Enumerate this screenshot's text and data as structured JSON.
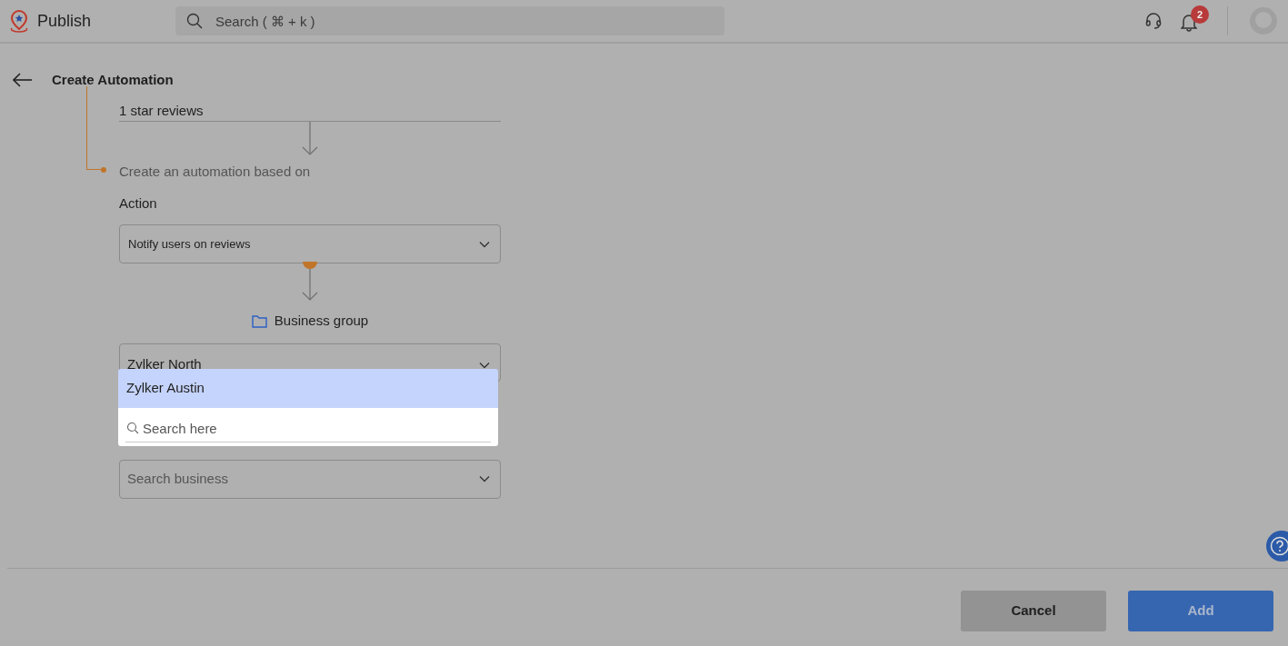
{
  "app": {
    "name": "Publish"
  },
  "search": {
    "placeholder": "Search ( ⌘ + k )"
  },
  "notifications": {
    "count": "2"
  },
  "page": {
    "title": "Create Automation"
  },
  "trigger": {
    "label": "1 star reviews"
  },
  "automation": {
    "caption": "Create an automation based on",
    "action_label": "Action",
    "action_value": "Notify users on reviews",
    "group_label": "Business group",
    "group_value": "Zylker North",
    "business_placeholder": "Search business"
  },
  "dropdown": {
    "options": [
      {
        "label": "Zylker Austin",
        "selected": true
      }
    ],
    "search_placeholder": "Search here"
  },
  "buttons": [
    {
      "label": "Cancel",
      "kind": "secondary"
    },
    {
      "label": "Add",
      "kind": "primary"
    }
  ]
}
